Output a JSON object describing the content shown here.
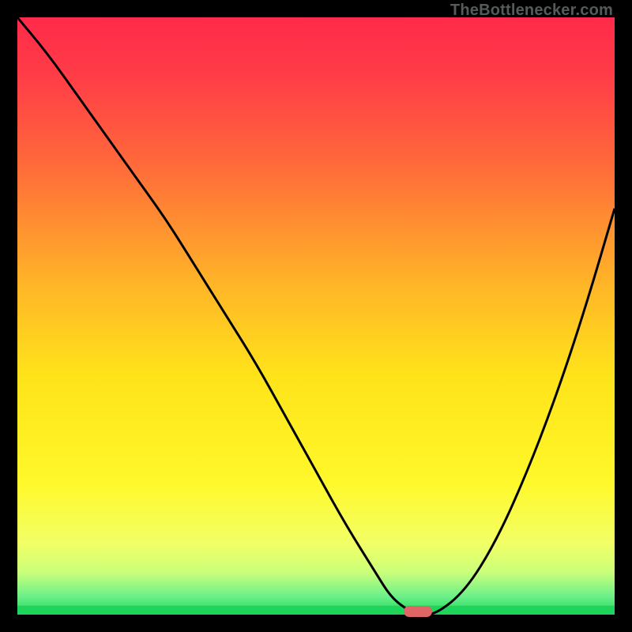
{
  "watermark": {
    "text": "TheBottlenecker.com"
  },
  "colors": {
    "frame": "#000000",
    "curve": "#000000",
    "marker": "#e06666",
    "green_band": "#1fd559",
    "gradient_stops": [
      {
        "offset": 0.0,
        "color": "#ff2a4a"
      },
      {
        "offset": 0.1,
        "color": "#ff3d47"
      },
      {
        "offset": 0.25,
        "color": "#ff6b3a"
      },
      {
        "offset": 0.45,
        "color": "#ffb627"
      },
      {
        "offset": 0.6,
        "color": "#ffe31a"
      },
      {
        "offset": 0.78,
        "color": "#fff82a"
      },
      {
        "offset": 0.88,
        "color": "#f2ff66"
      },
      {
        "offset": 0.93,
        "color": "#c9ff7a"
      },
      {
        "offset": 0.97,
        "color": "#6af089"
      },
      {
        "offset": 1.0,
        "color": "#1fd559"
      }
    ]
  },
  "chart_data": {
    "type": "line",
    "title": "",
    "xlabel": "",
    "ylabel": "",
    "xlim": [
      0,
      100
    ],
    "ylim": [
      0,
      100
    ],
    "x": [
      0,
      5,
      10,
      15,
      20,
      25,
      30,
      35,
      40,
      45,
      50,
      55,
      60,
      62.5,
      65,
      67,
      70,
      75,
      80,
      85,
      90,
      95,
      100
    ],
    "values": [
      100,
      94,
      87,
      80,
      73,
      66,
      58,
      50,
      42,
      33,
      24,
      15,
      7,
      3,
      1,
      0,
      0,
      4,
      12,
      23,
      36,
      51,
      68
    ],
    "curve_description": "Single black V-shaped curve on a vertical red→yellow→green gradient. Deep minimum (~0) around x≈66–68; left branch starts near 100 at x=0 and descends roughly linearly with slight curvature change near x≈15; right branch rises with increasing slope to ~68 at x=100.",
    "flat_bottom_range_x": [
      64,
      70
    ],
    "marker": {
      "x": 67,
      "y": 0.5,
      "shape": "rounded-bar",
      "color": "#e06666"
    }
  }
}
